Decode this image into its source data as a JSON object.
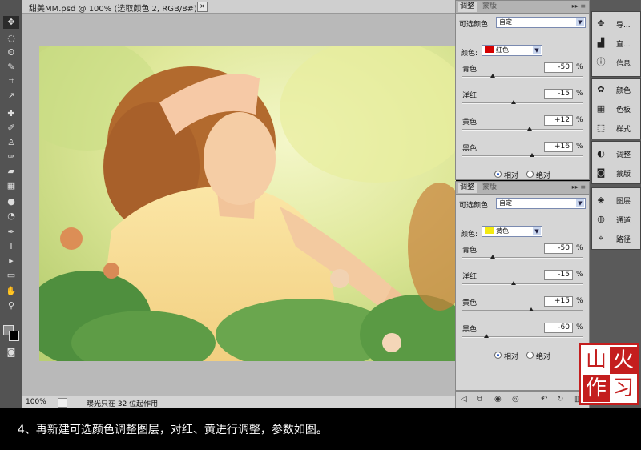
{
  "document": {
    "tab_title": "甜美MM.psd @ 100% (选取颜色 2, RGB/8#) *",
    "close_glyph": "×",
    "zoom": "100%",
    "status_text": "曝光只在 32 位起作用"
  },
  "adjustment_panels": [
    {
      "tab_active": "调整",
      "tab_inactive": "蒙版",
      "title": "可选颜色",
      "preset": "自定",
      "color_label": "颜色:",
      "color_value": "红色",
      "color_hex": "#d40000",
      "sliders": [
        {
          "label": "青色:",
          "value": "-50",
          "fraction": 0.25
        },
        {
          "label": "洋红:",
          "value": "-15",
          "fraction": 0.425
        },
        {
          "label": "黄色:",
          "value": "+12",
          "fraction": 0.56
        },
        {
          "label": "黑色:",
          "value": "+16",
          "fraction": 0.58
        }
      ],
      "percent": "%",
      "radio_relative": "相对",
      "radio_absolute": "绝对"
    },
    {
      "tab_active": "调整",
      "tab_inactive": "蒙版",
      "title": "可选颜色",
      "preset": "自定",
      "color_label": "颜色:",
      "color_value": "黄色",
      "color_hex": "#f3ea12",
      "sliders": [
        {
          "label": "青色:",
          "value": "-50",
          "fraction": 0.25
        },
        {
          "label": "洋红:",
          "value": "-15",
          "fraction": 0.425
        },
        {
          "label": "黄色:",
          "value": "+15",
          "fraction": 0.575
        },
        {
          "label": "黑色:",
          "value": "-60",
          "fraction": 0.2
        }
      ],
      "percent": "%",
      "radio_relative": "相对",
      "radio_absolute": "绝对"
    }
  ],
  "dock": {
    "group1": [
      "导...",
      "直...",
      "信息"
    ],
    "group2": [
      "颜色",
      "色板",
      "样式"
    ],
    "group3": [
      "调整",
      "蒙版"
    ],
    "group4": [
      "图层",
      "通道",
      "路径"
    ]
  },
  "seal": {
    "chars": [
      "山",
      "火",
      "作",
      "习"
    ]
  },
  "caption": "4、再新建可选颜色调整图层，对红、黄进行调整，参数如图。",
  "colors": {
    "ui_gray": "#d6d6d6",
    "seal_red": "#c41e1e",
    "canvas_gray": "#b9b9b9"
  }
}
